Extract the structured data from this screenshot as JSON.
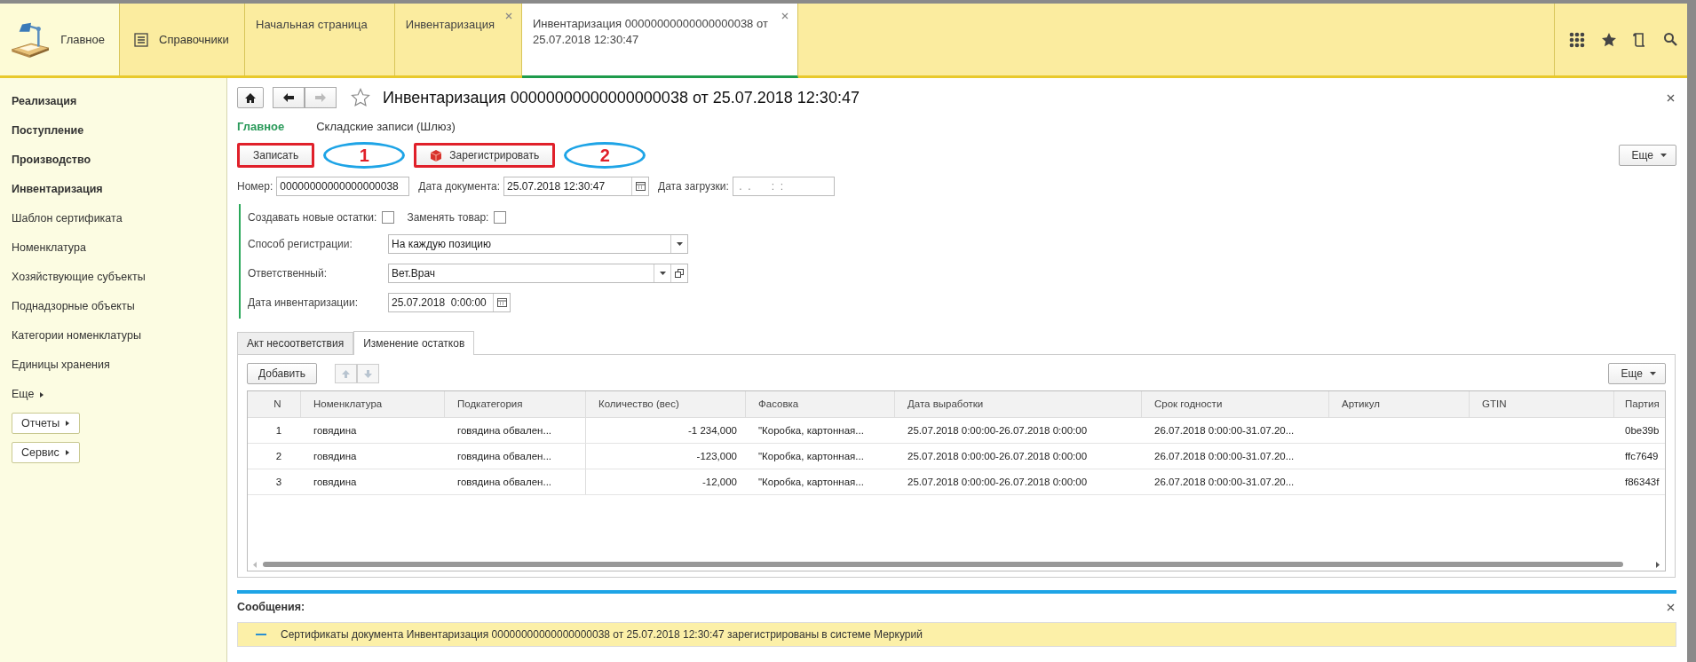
{
  "top_bar": {
    "sections": [
      {
        "label": "Главное",
        "kind": "logo"
      },
      {
        "label": "Справочники",
        "kind": "list"
      }
    ],
    "tabs": [
      {
        "label": "Начальная страница",
        "selected": false,
        "closable": false
      },
      {
        "label": "Инвентаризация",
        "selected": false,
        "closable": true
      },
      {
        "label": "Инвентаризация 00000000000000000038 от 25.07.2018 12:30:47",
        "selected": true,
        "closable": true
      }
    ]
  },
  "sidebar": {
    "items": [
      {
        "label": "Реализация",
        "kind": "section"
      },
      {
        "label": "Поступление",
        "kind": "section"
      },
      {
        "label": "Производство",
        "kind": "section"
      },
      {
        "label": "Инвентаризация",
        "kind": "section"
      },
      {
        "label": "Шаблон сертификата",
        "kind": "link"
      },
      {
        "label": "Номенклатура",
        "kind": "link"
      },
      {
        "label": "Хозяйствующие субъекты",
        "kind": "link"
      },
      {
        "label": "Поднадзорные объекты",
        "kind": "link"
      },
      {
        "label": "Категории номенклатуры",
        "kind": "link"
      },
      {
        "label": "Единицы хранения",
        "kind": "link"
      },
      {
        "label": "Еще",
        "kind": "more"
      },
      {
        "label": "Отчеты",
        "kind": "group"
      },
      {
        "label": "Сервис",
        "kind": "group"
      }
    ]
  },
  "form": {
    "title": "Инвентаризация 00000000000000000038 от 25.07.2018 12:30:47",
    "sections": [
      {
        "label": "Главное",
        "selected": true
      },
      {
        "label": "Складские записи (Шлюз)",
        "selected": false
      }
    ],
    "command_bar": {
      "buttons": [
        {
          "label": "Записать",
          "kind": "plain",
          "highlighted": true,
          "annotation": "1"
        },
        {
          "label": "Зарегистрировать",
          "kind": "register",
          "highlighted": true,
          "annotation": "2"
        }
      ],
      "more": "Еще"
    },
    "number": {
      "label": "Номер:",
      "value": "00000000000000000038"
    },
    "document_date": {
      "label": "Дата документа:",
      "value": "25.07.2018 12:30:47"
    },
    "load_date": {
      "label": "Дата загрузки:",
      "placeholder": " .  .       :  :"
    },
    "checkboxes": [
      {
        "label": "Создавать новые остатки:",
        "checked": false
      },
      {
        "label": "Заменять товар:",
        "checked": false
      }
    ],
    "registration_method": {
      "label": "Способ регистрации:",
      "value": "На каждую позицию"
    },
    "responsible": {
      "label": "Ответственный:",
      "value": "Вет.Врач"
    },
    "inventory_date": {
      "label": "Дата инвентаризации:",
      "value": "25.07.2018  0:00:00"
    },
    "tabs": [
      {
        "label": "Акт несоответствия",
        "selected": false
      },
      {
        "label": "Изменение остатков",
        "selected": true
      }
    ],
    "table_toolbar": {
      "add": "Добавить",
      "more": "Еще"
    },
    "table": {
      "columns": [
        "N",
        "Номенклатура",
        "Подкатегория",
        "Количество (вес)",
        "Фасовка",
        "Дата выработки",
        "Срок годности",
        "Артикул",
        "GTIN",
        "Партия"
      ],
      "rows": [
        [
          "1",
          "говядина",
          "говядина обвален...",
          "-1 234,000",
          "\"Коробка, картонная...",
          "25.07.2018 0:00:00-26.07.2018 0:00:00",
          "26.07.2018 0:00:00-31.07.20...",
          "",
          "",
          "0be39b"
        ],
        [
          "2",
          "говядина",
          "говядина обвален...",
          "-123,000",
          "\"Коробка, картонная...",
          "25.07.2018 0:00:00-26.07.2018 0:00:00",
          "26.07.2018 0:00:00-31.07.20...",
          "",
          "",
          "ffc7649"
        ],
        [
          "3",
          "говядина",
          "говядина обвален...",
          "-12,000",
          "\"Коробка, картонная...",
          "25.07.2018 0:00:00-26.07.2018 0:00:00",
          "26.07.2018 0:00:00-31.07.20...",
          "",
          "",
          "f86343f"
        ]
      ]
    }
  },
  "messages": {
    "title": "Сообщения:",
    "items": [
      "Сертификаты документа Инвентаризация 00000000000000000038 от 25.07.2018 12:30:47 зарегистрированы в системе Меркурий"
    ]
  }
}
